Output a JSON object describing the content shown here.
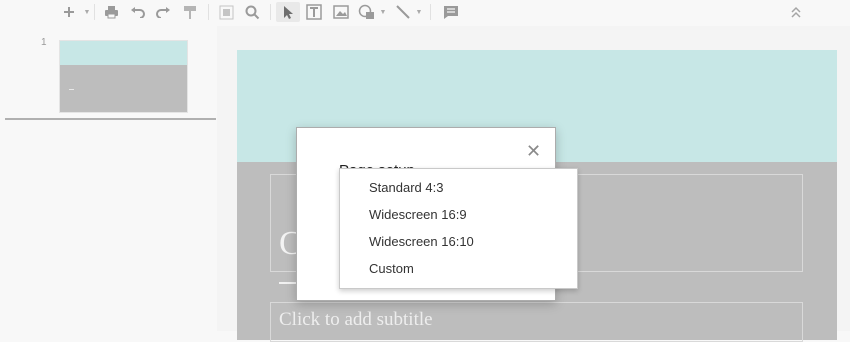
{
  "toolbar": {
    "icons": [
      "add-icon",
      "print-icon",
      "undo-icon",
      "redo-icon",
      "paint-format-icon",
      "fit-icon",
      "zoom-icon",
      "select-icon",
      "textbox-icon",
      "image-icon",
      "shape-icon",
      "line-icon",
      "comment-icon",
      "collapse-icon"
    ]
  },
  "filmstrip": {
    "slide_number": "1",
    "thumb_colors": {
      "top": "#c7e7e6",
      "bottom": "#bdbdbd"
    }
  },
  "slide": {
    "title_placeholder": "C",
    "subtitle_placeholder": "Click to add subtitle",
    "colors": {
      "top": "#c7e7e6",
      "bottom": "#bdbdbd"
    }
  },
  "dialog": {
    "title": "Page setup",
    "close": "✕"
  },
  "menu": {
    "items": [
      "Standard 4:3",
      "Widescreen 16:9",
      "Widescreen 16:10",
      "Custom"
    ]
  }
}
